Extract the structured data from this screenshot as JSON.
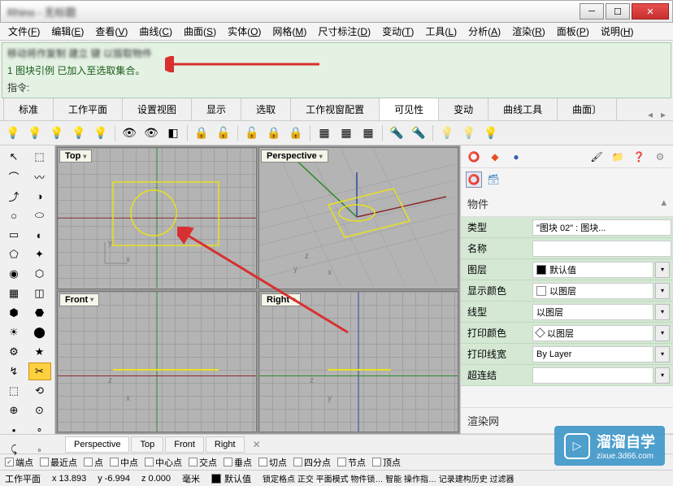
{
  "titlebar": {
    "text": "Rhino - 无标题"
  },
  "menu": [
    {
      "label": "文件",
      "key": "F"
    },
    {
      "label": "编辑",
      "key": "E"
    },
    {
      "label": "查看",
      "key": "V"
    },
    {
      "label": "曲线",
      "key": "C"
    },
    {
      "label": "曲面",
      "key": "S"
    },
    {
      "label": "实体",
      "key": "O"
    },
    {
      "label": "网格",
      "key": "M"
    },
    {
      "label": "尺寸标注",
      "key": "D"
    },
    {
      "label": "变动",
      "key": "T"
    },
    {
      "label": "工具",
      "key": "L"
    },
    {
      "label": "分析",
      "key": "A"
    },
    {
      "label": "渲染",
      "key": "R"
    },
    {
      "label": "面板",
      "key": "P"
    },
    {
      "label": "说明",
      "key": "H"
    }
  ],
  "cmd": {
    "blurred": "移动将作复制 建立 键 以毁取物件",
    "msg": "1 图块引例 已加入至选取集合。",
    "prompt": "指令:"
  },
  "tabs": [
    "标准",
    "工作平面",
    "设置视图",
    "显示",
    "选取",
    "工作视窗配置",
    "可见性",
    "变动",
    "曲线工具",
    "曲面〕"
  ],
  "active_tab": 6,
  "viewports": {
    "top": "Top",
    "perspective": "Perspective",
    "front": "Front",
    "right": "Right"
  },
  "view_tabs": [
    "Perspective",
    "Top",
    "Front",
    "Right"
  ],
  "active_view_tab": 0,
  "panel": {
    "header": "物件",
    "rows": [
      {
        "label": "类型",
        "value": "\"图块 02\" : 图块...",
        "swatch": null,
        "dd": false
      },
      {
        "label": "名称",
        "value": "",
        "swatch": null,
        "dd": false
      },
      {
        "label": "图层",
        "value": "默认值",
        "swatch": "#000",
        "dd": true
      },
      {
        "label": "显示颜色",
        "value": "以图层",
        "swatch": "#fff",
        "dd": true
      },
      {
        "label": "线型",
        "value": "以图层",
        "swatch": null,
        "dd": true
      },
      {
        "label": "打印颜色",
        "value": "以图层",
        "swatch": "diamond",
        "dd": true
      },
      {
        "label": "打印线宽",
        "value": "By Layer",
        "swatch": null,
        "dd": true
      },
      {
        "label": "超连结",
        "value": "",
        "swatch": null,
        "dd": true
      }
    ],
    "footer": "渲染网"
  },
  "snaps": [
    {
      "label": "端点",
      "checked": true
    },
    {
      "label": "最近点",
      "checked": false
    },
    {
      "label": "点",
      "checked": false
    },
    {
      "label": "中点",
      "checked": false
    },
    {
      "label": "中心点",
      "checked": false
    },
    {
      "label": "交点",
      "checked": false
    },
    {
      "label": "垂点",
      "checked": false
    },
    {
      "label": "切点",
      "checked": false
    },
    {
      "label": "四分点",
      "checked": false
    },
    {
      "label": "节点",
      "checked": false
    },
    {
      "label": "顶点",
      "checked": false
    }
  ],
  "status": {
    "plane": "工作平面",
    "x": "x 13.893",
    "y": "y -6.994",
    "z": "z 0.000",
    "unit": "毫米",
    "layer": "默认值",
    "rest": "锁定格点 正交 平面模式 物件锁… 智能 操作指… 记录建构历史 过滤器"
  },
  "watermark": {
    "brand": "溜溜自学",
    "url": "zixue.3d66.com"
  }
}
